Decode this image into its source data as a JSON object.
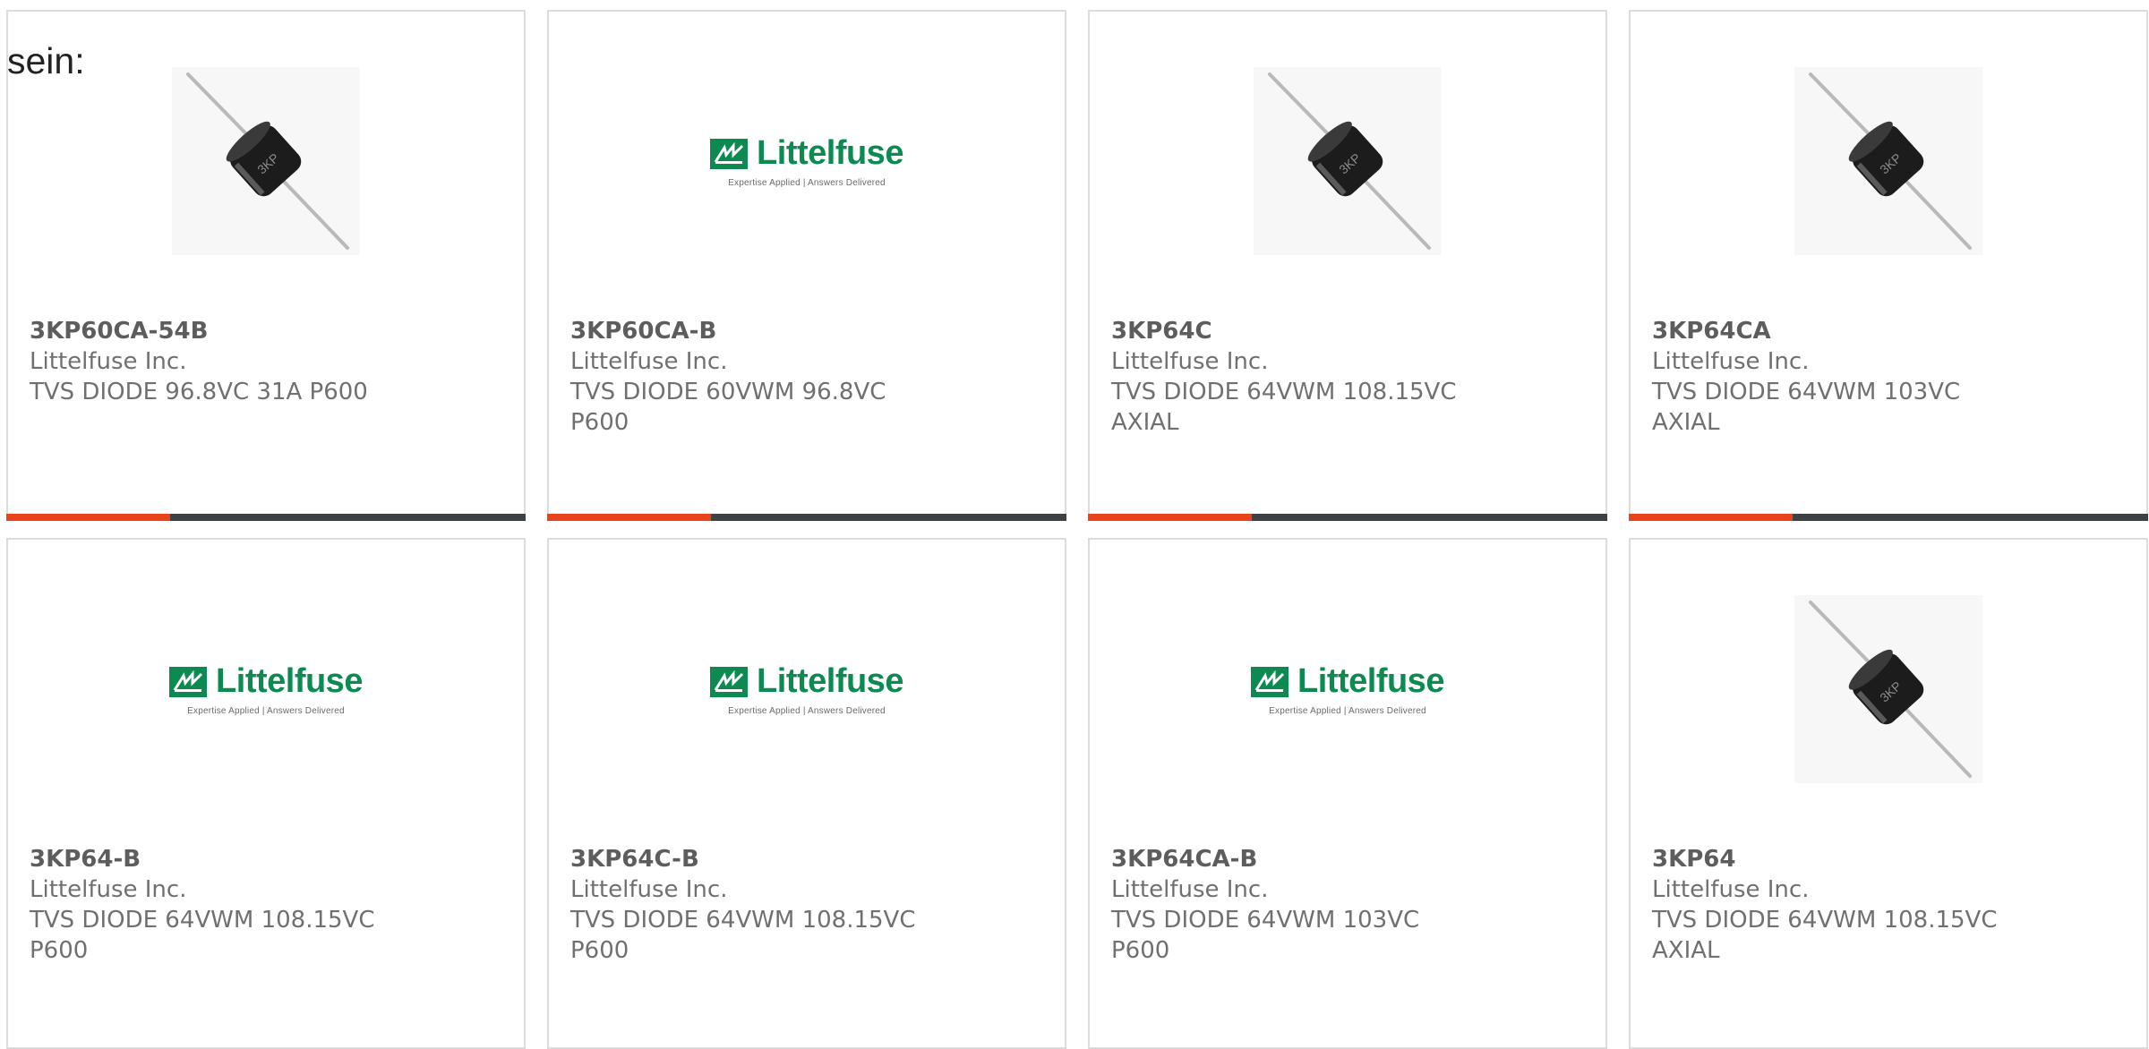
{
  "intro_text": "sein:",
  "colors": {
    "accent_bar": "#e8431a",
    "bar_dark": "#3d4143",
    "brand_green": "#0d8a52"
  },
  "logo": {
    "name": "Littelfuse",
    "tagline": "Expertise Applied | Answers Delivered"
  },
  "products": [
    {
      "part": "3KP60CA-54B",
      "manufacturer": "Littelfuse Inc.",
      "description": "TVS DIODE 96.8VC 31A P600",
      "image": "diode-photo",
      "hover_bar": true
    },
    {
      "part": "3KP60CA-B",
      "manufacturer": "Littelfuse Inc.",
      "description": "TVS DIODE 60VWM 96.8VC P600",
      "image": "littelfuse-logo",
      "hover_bar": true
    },
    {
      "part": "3KP64C",
      "manufacturer": "Littelfuse Inc.",
      "description": "TVS DIODE 64VWM 108.15VC AXIAL",
      "image": "diode-photo",
      "hover_bar": true
    },
    {
      "part": "3KP64CA",
      "manufacturer": "Littelfuse Inc.",
      "description": "TVS DIODE 64VWM 103VC AXIAL",
      "image": "diode-photo",
      "hover_bar": true
    },
    {
      "part": "3KP64-B",
      "manufacturer": "Littelfuse Inc.",
      "description": "TVS DIODE 64VWM 108.15VC P600",
      "image": "littelfuse-logo",
      "hover_bar": false
    },
    {
      "part": "3KP64C-B",
      "manufacturer": "Littelfuse Inc.",
      "description": "TVS DIODE 64VWM 108.15VC P600",
      "image": "littelfuse-logo",
      "hover_bar": false
    },
    {
      "part": "3KP64CA-B",
      "manufacturer": "Littelfuse Inc.",
      "description": "TVS DIODE 64VWM 103VC P600",
      "image": "littelfuse-logo",
      "hover_bar": false
    },
    {
      "part": "3KP64",
      "manufacturer": "Littelfuse Inc.",
      "description": "TVS DIODE 64VWM 108.15VC AXIAL",
      "image": "diode-photo",
      "hover_bar": false
    }
  ]
}
